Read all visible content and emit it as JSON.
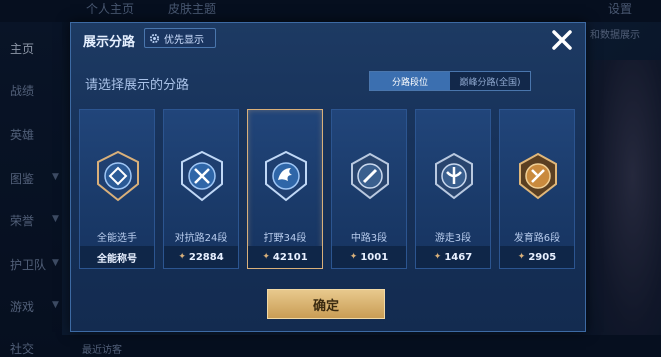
{
  "background": {
    "tabs": [
      "个人主页",
      "皮肤主题",
      "设置"
    ],
    "sidebar": [
      {
        "label": "主页",
        "active": true
      },
      {
        "label": "战绩"
      },
      {
        "label": "英雄"
      },
      {
        "label": "图鉴"
      },
      {
        "label": "荣誉"
      },
      {
        "label": "护卫队"
      },
      {
        "label": "游戏"
      },
      {
        "label": "社交"
      }
    ],
    "right_text": "和数据展示",
    "bottom_text": "最近访客"
  },
  "dialog": {
    "title": "展示分路",
    "pref_button": "优先显示",
    "subtitle": "请选择展示的分路",
    "tabs": [
      "分路段位",
      "巅峰分路(全国)"
    ],
    "active_tab": 0,
    "confirm": "确定",
    "cards": [
      {
        "name": "全能选手",
        "footer": "全能称号",
        "footer_mark": false,
        "icon": "all-round-emblem-icon",
        "selected": false
      },
      {
        "name": "对抗路24段",
        "footer": "22884",
        "footer_mark": true,
        "icon": "clash-lane-emblem-icon",
        "selected": false
      },
      {
        "name": "打野34段",
        "footer": "42101",
        "footer_mark": true,
        "icon": "jungle-emblem-icon",
        "selected": true
      },
      {
        "name": "中路3段",
        "footer": "1001",
        "footer_mark": true,
        "icon": "mid-lane-emblem-icon",
        "selected": false
      },
      {
        "name": "游走3段",
        "footer": "1467",
        "footer_mark": true,
        "icon": "roam-emblem-icon",
        "selected": false
      },
      {
        "name": "发育路6段",
        "footer": "2905",
        "footer_mark": true,
        "icon": "farm-lane-emblem-icon",
        "selected": false
      }
    ],
    "footer_mark_glyph": "✦"
  },
  "colors": {
    "accent_gold": "#d9b07a",
    "tab_active": "#3b6fb0"
  }
}
